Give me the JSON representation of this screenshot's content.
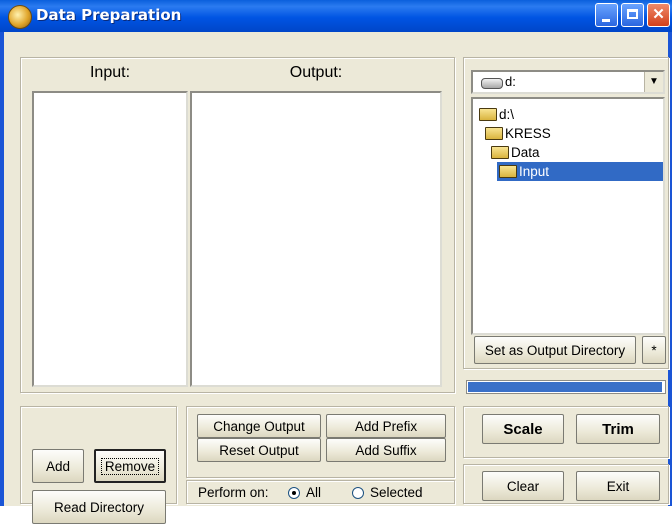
{
  "window": {
    "title": "Data Preparation"
  },
  "lists": {
    "input_header": "Input:",
    "output_header": "Output:"
  },
  "drive": {
    "value": "d:",
    "arrow": "▼"
  },
  "tree": {
    "items": [
      {
        "label": "d:\\",
        "selected": false
      },
      {
        "label": "KRESS",
        "selected": false
      },
      {
        "label": "Data",
        "selected": false
      },
      {
        "label": "Input",
        "selected": true
      }
    ]
  },
  "buttons": {
    "set_output_dir": "Set as Output Directory",
    "small": "*",
    "add": "Add",
    "remove": "Remove",
    "read_directory": "Read Directory",
    "change_output": "Change Output",
    "reset_output": "Reset Output",
    "add_prefix": "Add Prefix",
    "add_suffix": "Add Suffix",
    "scale": "Scale",
    "trim": "Trim",
    "clear": "Clear",
    "exit": "Exit"
  },
  "perform_on": {
    "label": "Perform on:",
    "options": [
      {
        "label": "All",
        "checked": true
      },
      {
        "label": "Selected",
        "checked": false
      }
    ]
  },
  "progress": {
    "fraction": 0.99
  },
  "colors": {
    "titlebar": "#0054e3",
    "selection": "#316ac5",
    "progress": "#3a70c8",
    "close": "#d2401a"
  },
  "icons": {
    "app": "app-gear-icon",
    "drive": "drive-icon",
    "folder": "folder-icon"
  }
}
